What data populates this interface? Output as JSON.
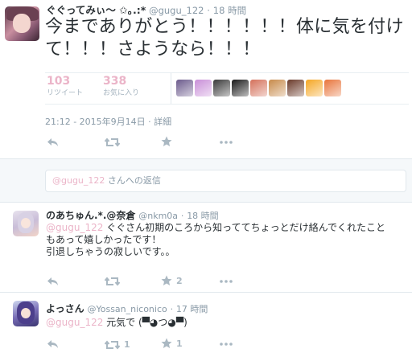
{
  "main_tweet": {
    "display_name": "ぐぐってみぃ〜 ✩｡.:*",
    "handle": "@gugu_122",
    "separator": "·",
    "time": "18 時間",
    "text_line1": "今までありがとう！！！！！！体に気を付け",
    "text_line2": "て！！！さようなら！！！",
    "retweets": {
      "count": "103",
      "label": "リツイート"
    },
    "favorites": {
      "count": "338",
      "label": "お気に入り"
    },
    "timestamp": "21:12 - 2015年9月14日",
    "meta_sep": "·",
    "details_link": "詳細",
    "favoriter_avatar_colors": [
      "#6b5a8c",
      "#c98fd8",
      "#3a3a3a",
      "#1a1a1a",
      "#d4705a",
      "#c78a4a",
      "#6a3a2a",
      "#f5a623",
      "#e8743b"
    ]
  },
  "reply_box": {
    "to": "@gugu_122",
    "suffix": " さんへの返信"
  },
  "replies": [
    {
      "display_name": "のあちゅん.*.@奈倉",
      "handle": "@nkm0a",
      "separator": "·",
      "time": "18 時間",
      "mention": "@gugu_122",
      "text_line1": " ぐぐさん初期のころから知っててちょっとだけ絡んでくれたこと",
      "text_line2": "もあって嬉しかったです！",
      "text_line3": "引退しちゃうの寂しいです。。",
      "retweet_count": "",
      "favorite_count": "2"
    },
    {
      "display_name": "よっさん",
      "handle": "@Yossan_niconico",
      "separator": "·",
      "time": "17 時間",
      "mention": "@gugu_122",
      "text_line1": " 元気で (▀◕つ◕▀)",
      "retweet_count": "1",
      "favorite_count": "1"
    }
  ],
  "icons": {
    "reply": "reply-icon",
    "retweet": "retweet-icon",
    "favorite": "star-icon",
    "more": "more-icon"
  },
  "colors": {
    "link": "#ebb4c8",
    "muted": "#8899a6",
    "action_icon": "#aab8c2"
  }
}
